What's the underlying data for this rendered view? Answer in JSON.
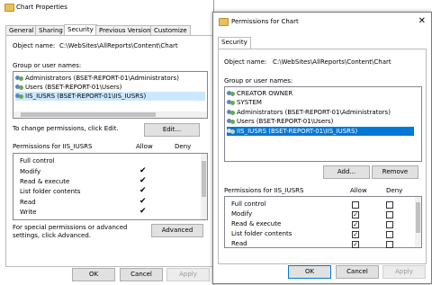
{
  "back": {
    "title": "Chart Properties",
    "tabs": [
      "General",
      "Sharing",
      "Security",
      "Previous Versions",
      "Customize"
    ],
    "object_name_label": "Object name:",
    "object_name_value": "C:\\WebSites\\AllReports\\Content\\Chart",
    "groups_label": "Group or user names:",
    "users": [
      "Administrators (BSET-REPORT-01\\Administrators)",
      "Users (BSET-REPORT-01\\Users)",
      "IIS_IUSRS (BSET-REPORT-01\\IIS_IUSRS)"
    ],
    "change_text": "To change permissions, click Edit.",
    "edit_button": "Edit...",
    "perms_label": "Permissions for IIS_IUSRS",
    "allow_header": "Allow",
    "deny_header": "Deny",
    "permissions": [
      {
        "name": "Full control",
        "allow": false
      },
      {
        "name": "Modify",
        "allow": true
      },
      {
        "name": "Read & execute",
        "allow": true
      },
      {
        "name": "List folder contents",
        "allow": true
      },
      {
        "name": "Read",
        "allow": true
      },
      {
        "name": "Write",
        "allow": true
      }
    ],
    "special_text": "For special permissions or advanced settings, click Advanced.",
    "advanced_button": "Advanced",
    "ok_button": "OK",
    "cancel_button": "Cancel",
    "apply_button": "Apply",
    "close_glyph": "✕"
  },
  "front": {
    "title": "Permissions for Chart",
    "tab": "Security",
    "object_name_label": "Object name:",
    "object_name_value": "C:\\WebSites\\AllReports\\Content\\Chart",
    "groups_label": "Group or user names:",
    "users": [
      "CREATOR OWNER",
      "SYSTEM",
      "Administrators (BSET-REPORT-01\\Administrators)",
      "Users (BSET-REPORT-01\\Users)",
      "IIS_IUSRS (BSET-REPORT-01\\IIS_IUSRS)"
    ],
    "add_button": "Add...",
    "remove_button": "Remove",
    "perms_label": "Permissions for IIS_IUSRS",
    "allow_header": "Allow",
    "deny_header": "Deny",
    "permissions": [
      {
        "name": "Full control",
        "allow": false,
        "deny": false
      },
      {
        "name": "Modify",
        "allow": true,
        "deny": false
      },
      {
        "name": "Read & execute",
        "allow": true,
        "deny": false
      },
      {
        "name": "List folder contents",
        "allow": true,
        "deny": false
      },
      {
        "name": "Read",
        "allow": true,
        "deny": false
      }
    ],
    "ok_button": "OK",
    "cancel_button": "Cancel",
    "apply_button": "Apply",
    "close_glyph": "✕"
  },
  "check_glyph": "✓",
  "checkmark_glyph": "✔",
  "colors": {
    "selection": "#cce8ff",
    "selection_strong": "#0078d7",
    "folder": "#e8c15a"
  }
}
